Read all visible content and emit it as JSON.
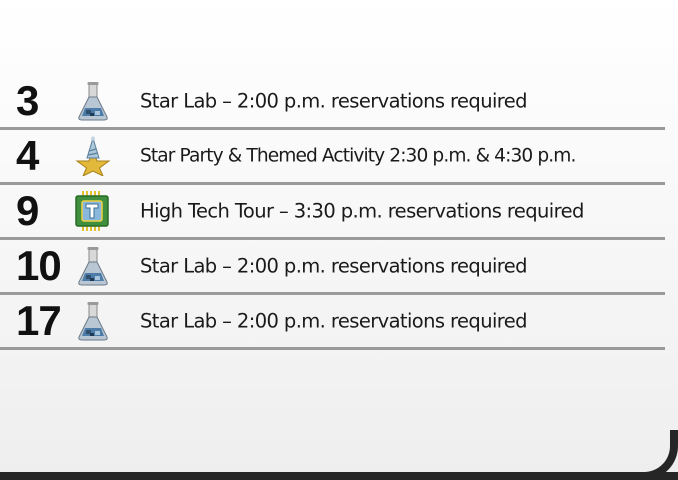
{
  "events": [
    {
      "day": "3",
      "icon": "flask-icon",
      "text": "Star Lab – 2:00 p.m. reservations required"
    },
    {
      "day": "4",
      "icon": "star-party-icon",
      "text": "Star Party & Themed Activity 2:30 p.m. & 4:30 p.m."
    },
    {
      "day": "9",
      "icon": "high-tech-chip-icon",
      "text": "High Tech Tour – 3:30 p.m. reservations required"
    },
    {
      "day": "10",
      "icon": "flask-icon",
      "text": "Star Lab – 2:00 p.m. reservations required"
    },
    {
      "day": "17",
      "icon": "flask-icon",
      "text": "Star Lab – 2:00 p.m. reservations required"
    }
  ]
}
